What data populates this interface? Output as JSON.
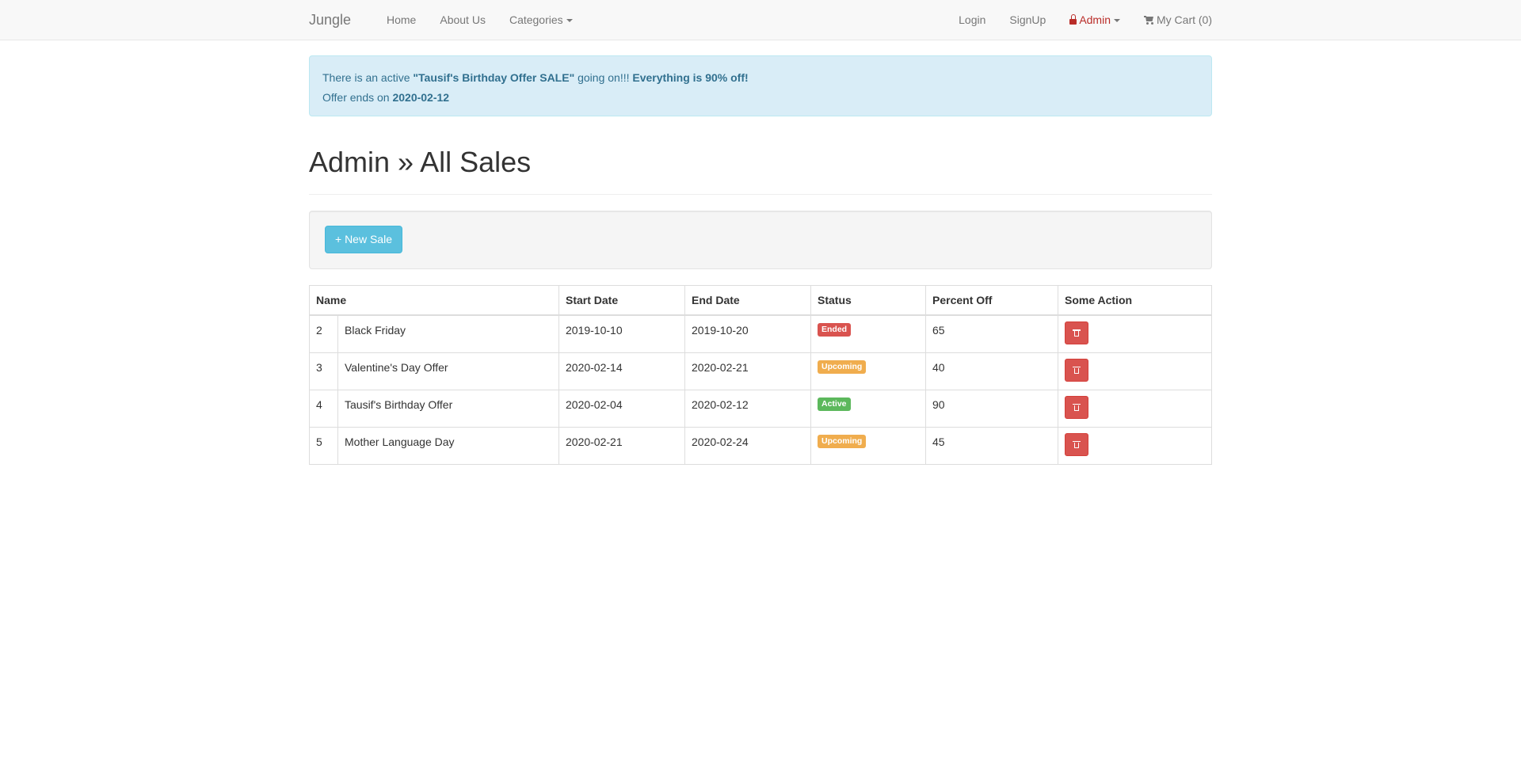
{
  "navbar": {
    "brand": "Jungle",
    "left_links": [
      "Home",
      "About Us",
      "Categories"
    ],
    "login": "Login",
    "signup": "SignUp",
    "admin": "Admin",
    "cart": "My Cart (0)"
  },
  "alert": {
    "prefix": "There is an active ",
    "sale_name": "\"Tausif's Birthday Offer SALE\"",
    "middle": " going on!!! ",
    "discount_text": "Everything is 90% off!",
    "ends_prefix": "Offer ends on ",
    "ends_date": "2020-02-12"
  },
  "page_title": "Admin » All Sales",
  "new_sale_button": "+ New Sale",
  "table": {
    "headers": [
      "Name",
      "Start Date",
      "End Date",
      "Status",
      "Percent Off",
      "Some Action"
    ],
    "rows": [
      {
        "id": "2",
        "name": "Black Friday",
        "start": "2019-10-10",
        "end": "2019-10-20",
        "status": "Ended",
        "percent": "65"
      },
      {
        "id": "3",
        "name": "Valentine's Day Offer",
        "start": "2020-02-14",
        "end": "2020-02-21",
        "status": "Upcoming",
        "percent": "40"
      },
      {
        "id": "4",
        "name": "Tausif's Birthday Offer",
        "start": "2020-02-04",
        "end": "2020-02-12",
        "status": "Active",
        "percent": "90"
      },
      {
        "id": "5",
        "name": "Mother Language Day",
        "start": "2020-02-21",
        "end": "2020-02-24",
        "status": "Upcoming",
        "percent": "45"
      }
    ]
  },
  "status_colors": {
    "Ended": "#d9534f",
    "Upcoming": "#f0ad4e",
    "Active": "#5cb85c"
  },
  "icons": {
    "admin": "lock-icon",
    "cart": "cart-icon",
    "delete": "trash-icon"
  }
}
